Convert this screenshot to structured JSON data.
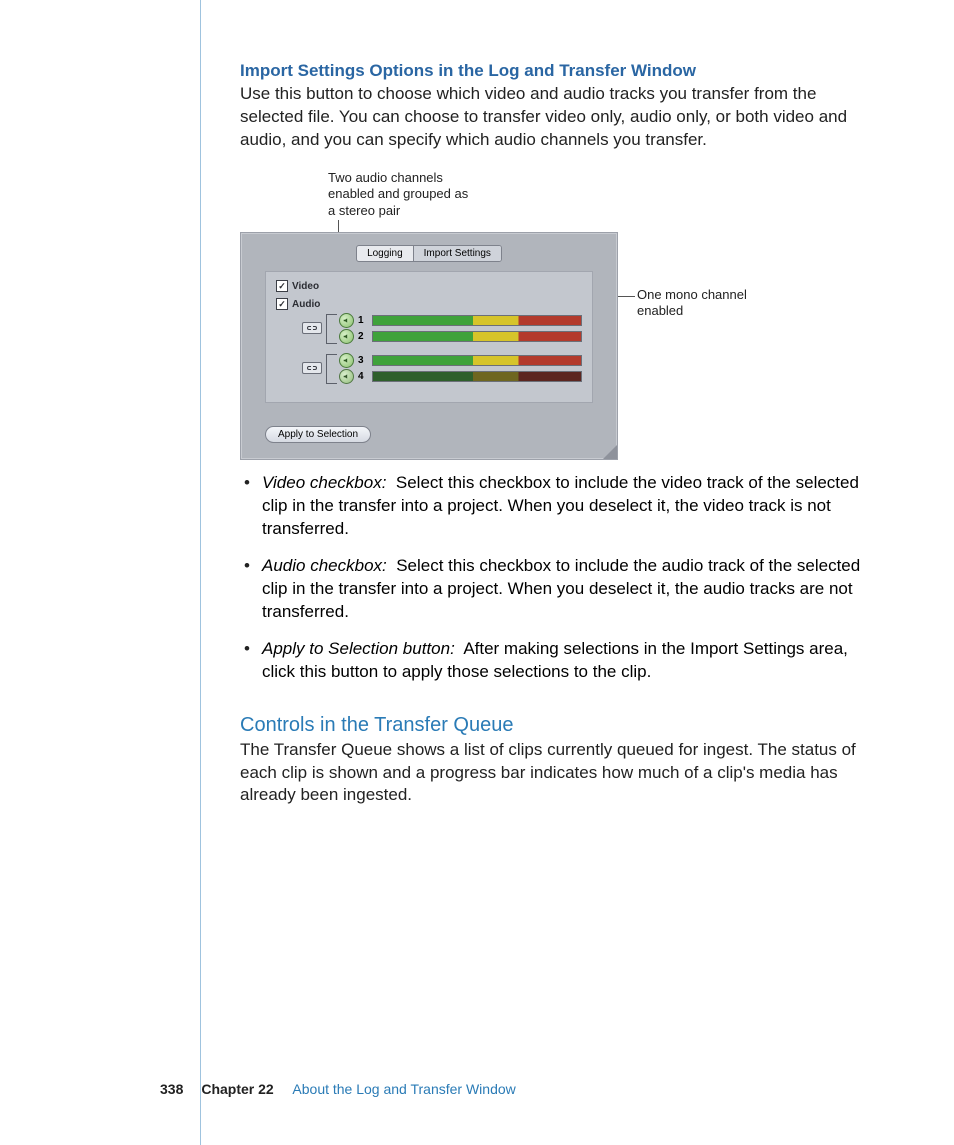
{
  "section1": {
    "heading": "Import Settings Options in the Log and Transfer Window",
    "intro": "Use this button to choose which video and audio tracks you transfer from the selected file. You can choose to transfer video only, audio only, or both video and audio, and you can specify which audio channels you transfer."
  },
  "figure": {
    "callout_top": "Two audio channels enabled and grouped as a stereo pair",
    "callout_right": "One mono channel enabled",
    "tabs": [
      "Logging",
      "Import Settings"
    ],
    "video_label": "Video",
    "audio_label": "Audio",
    "channels": [
      "1",
      "2",
      "3",
      "4"
    ],
    "apply_label": "Apply to Selection"
  },
  "bullets": [
    {
      "term": "Video checkbox:",
      "desc": "Select this checkbox to include the video track of the selected clip in the transfer into a project. When you deselect it, the video track is not transferred."
    },
    {
      "term": "Audio checkbox:",
      "desc": "Select this checkbox to include the audio track of the selected clip in the transfer into a project. When you deselect it, the audio tracks are not transferred."
    },
    {
      "term": "Apply to Selection button:",
      "desc": "After making selections in the Import Settings area, click this button to apply those selections to the clip."
    }
  ],
  "section2": {
    "heading": "Controls in the Transfer Queue",
    "body": "The Transfer Queue shows a list of clips currently queued for ingest. The status of each clip is shown and a progress bar indicates how much of a clip's media has already been ingested."
  },
  "footer": {
    "page": "338",
    "chapter": "Chapter 22",
    "title": "About the Log and Transfer Window"
  }
}
